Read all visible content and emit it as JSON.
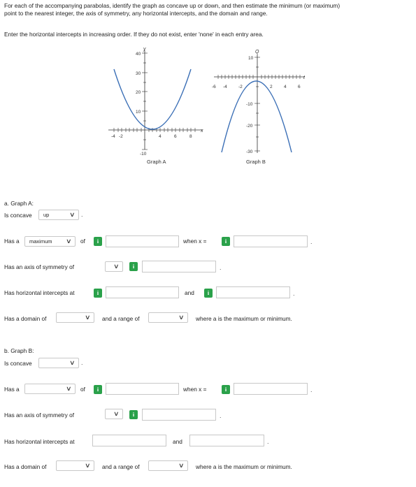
{
  "instructions": {
    "line1": "For each of the accompanying parabolas, identify the graph as concave up or down, and then estimate the minimum (or maximum)",
    "line2": "point to the nearest integer, the axis of symmetry, any horizontal intercepts, and the domain and range.",
    "line3": "Enter the horizontal intercepts in increasing order. If they do not exist, enter 'none' in each entry area."
  },
  "graph_a": {
    "caption": "Graph A",
    "y_axis_label": "y",
    "x_axis_label": "x",
    "y_ticks": [
      "40",
      "30",
      "20",
      "10",
      "-10"
    ],
    "x_ticks": [
      "-4",
      "-2",
      "4",
      "6",
      "8"
    ]
  },
  "graph_b": {
    "caption": "Graph B",
    "y_axis_label": "Q",
    "x_axis_label": "t",
    "y_ticks": [
      "10",
      "-10",
      "-20",
      "-30"
    ],
    "x_ticks": [
      "-6",
      "-4",
      "-2",
      "2",
      "4",
      "6"
    ]
  },
  "part_a": {
    "heading": "a. Graph A:",
    "concave_label": "Is concave",
    "concave_value": "up",
    "has_a_label": "Has a",
    "extreme_value": "maximum",
    "of_label": "of",
    "when_label": "when x =",
    "axis_label": "Has an axis of symmetry of",
    "intercepts_label": "Has horizontal intercepts at",
    "and_label": "and",
    "domain_label": "Has a domain of",
    "range_label": "and a range of",
    "where_label": "where a is the maximum or minimum."
  },
  "part_b": {
    "heading": "b. Graph B:",
    "concave_label": "Is concave",
    "concave_value": "",
    "has_a_label": "Has a",
    "extreme_value": "",
    "of_label": "of",
    "when_label": "when x =",
    "axis_label": "Has an axis of symmetry of",
    "intercepts_label": "Has horizontal intercepts at",
    "and_label": "and",
    "domain_label": "Has a domain of",
    "range_label": "and a range of",
    "where_label": "where a is the maximum or minimum."
  },
  "icons": {
    "info": "info-icon",
    "dropdown": "chevron-down-icon"
  },
  "colors": {
    "info_button": "#2aa14a",
    "field_border": "#c8c8c8"
  }
}
